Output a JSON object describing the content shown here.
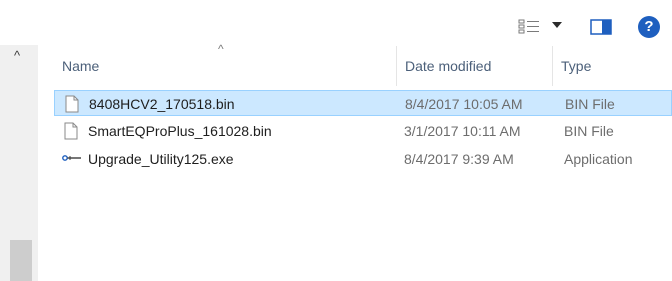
{
  "toolbar": {
    "icons": [
      "view-details-icon",
      "chevron-down-icon",
      "preview-pane-icon",
      "help-icon"
    ],
    "help_glyph": "?"
  },
  "columns": {
    "name": "Name",
    "date_modified": "Date modified",
    "type": "Type"
  },
  "files": [
    {
      "name": "8408HCV2_170518.bin",
      "date": "8/4/2017 10:05 AM",
      "type": "BIN File",
      "icon": "file-icon",
      "selected": true
    },
    {
      "name": "SmartEQProPlus_161028.bin",
      "date": "3/1/2017 10:11 AM",
      "type": "BIN File",
      "icon": "file-icon",
      "selected": false
    },
    {
      "name": "Upgrade_Utility125.exe",
      "date": "8/4/2017 9:39 AM",
      "type": "Application",
      "icon": "exe-icon",
      "selected": false
    }
  ],
  "colors": {
    "selection_bg": "#cce8ff",
    "selection_border": "#99d1ff",
    "header_text": "#4c607a",
    "help_blue": "#1e5fbf"
  }
}
